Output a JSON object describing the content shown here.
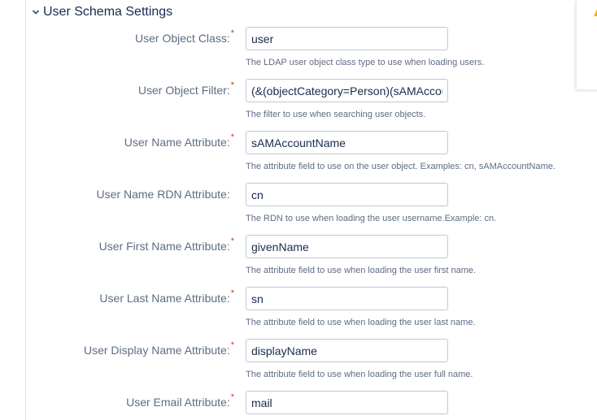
{
  "section": {
    "title": "User Schema Settings",
    "icon": "chevron-down-icon"
  },
  "colors": {
    "label": "#5e6c84",
    "required": "#de350b",
    "input_border": "#c1c7d0",
    "warning": "#ffab00"
  },
  "fields": [
    {
      "label": "User Object Class:",
      "required": true,
      "value": "user",
      "help": "The LDAP user object class type to use when loading users."
    },
    {
      "label": "User Object Filter:",
      "required": true,
      "value": "(&(objectCategory=Person)(sAMAccou",
      "help": "The filter to use when searching user objects."
    },
    {
      "label": "User Name Attribute:",
      "required": true,
      "value": "sAMAccountName",
      "help": "The attribute field to use on the user object. Examples: cn, sAMAccountName."
    },
    {
      "label": "User Name RDN Attribute:",
      "required": false,
      "value": "cn",
      "help": "The RDN to use when loading the user username.Example: cn."
    },
    {
      "label": "User First Name Attribute:",
      "required": true,
      "value": "givenName",
      "help": "The attribute field to use when loading the user first name."
    },
    {
      "label": "User Last Name Attribute:",
      "required": true,
      "value": "sn",
      "help": "The attribute field to use when loading the user last name."
    },
    {
      "label": "User Display Name Attribute:",
      "required": true,
      "value": "displayName",
      "help": "The attribute field to use when loading the user full name."
    },
    {
      "label": "User Email Attribute:",
      "required": true,
      "value": "mail",
      "help": ""
    }
  ],
  "required_marker": "*",
  "side_panel": {
    "icon": "warning-icon"
  }
}
